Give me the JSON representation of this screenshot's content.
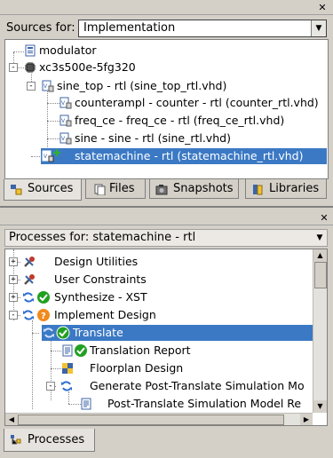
{
  "sources": {
    "label": "Sources for:",
    "combo_value": "Implementation",
    "tree": [
      {
        "label": "modulator"
      },
      {
        "label": "xc3s500e-5fg320"
      },
      {
        "label": "sine_top - rtl (sine_top_rtl.vhd)"
      },
      {
        "label": "counterampl - counter - rtl (counter_rtl.vhd)"
      },
      {
        "label": "freq_ce - freq_ce - rtl (freq_ce_rtl.vhd)"
      },
      {
        "label": "sine - sine - rtl (sine_rtl.vhd)"
      },
      {
        "label": "statemachine - rtl (statemachine_rtl.vhd)",
        "selected": true
      }
    ],
    "tabs": [
      {
        "label": "Sources",
        "icon": "sources-icon"
      },
      {
        "label": "Files",
        "icon": "files-icon"
      },
      {
        "label": "Snapshots",
        "icon": "snapshots-icon"
      },
      {
        "label": "Libraries",
        "icon": "libraries-icon"
      }
    ]
  },
  "processes": {
    "header": "Processes for: statemachine - rtl",
    "tree": [
      {
        "label": "Design Utilities",
        "icon": "tools-icon"
      },
      {
        "label": "User Constraints",
        "icon": "tools-icon"
      },
      {
        "label": "Synthesize - XST",
        "icon": "check-status-icon"
      },
      {
        "label": "Implement Design",
        "icon": "warning-status-icon"
      },
      {
        "label": "Translate",
        "icon": "check-status-icon",
        "selected": true
      },
      {
        "label": "Translation Report",
        "icon": "report-icon"
      },
      {
        "label": "Floorplan Design",
        "icon": "floorplan-icon"
      },
      {
        "label": "Generate Post-Translate Simulation Mo",
        "icon": "run-icon"
      },
      {
        "label": "Post-Translate Simulation Model Re",
        "icon": "report-icon"
      }
    ],
    "tab": {
      "label": "Processes"
    }
  },
  "colors": {
    "selection": "#3b79c4",
    "check": "#22a022",
    "warning": "#f08a1c",
    "refresh": "#2f6fd0"
  }
}
